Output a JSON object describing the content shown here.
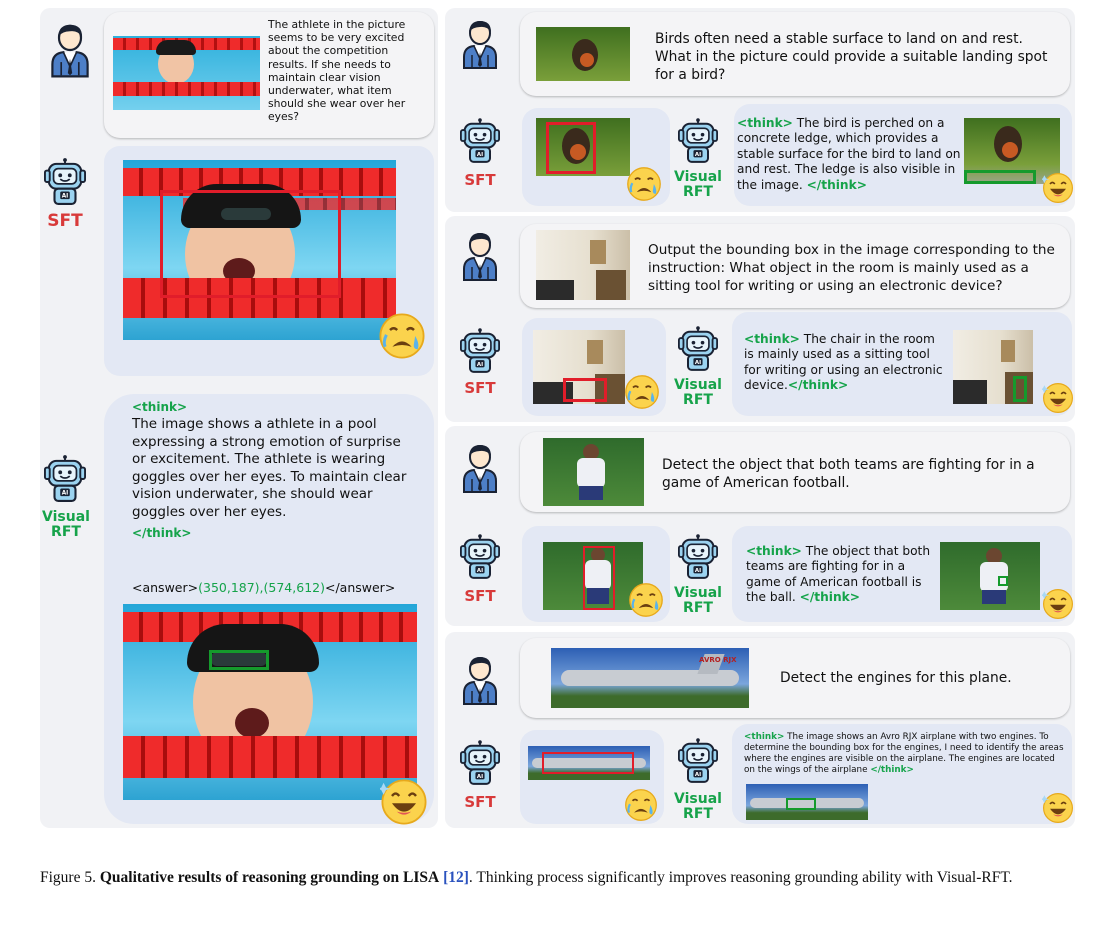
{
  "left": {
    "question": "The athlete in the picture seems to be very excited about the competition results. If she needs to maintain clear vision underwater, what item should she wear over her eyes?",
    "sft_label": "SFT",
    "rft_label": "Visual RFT",
    "think_open": "<think>",
    "think_body": "The image shows a athlete in a pool expressing a strong emotion of surprise or excitement. The athlete is wearing goggles over her eyes. To maintain clear vision underwater, she should wear goggles over her eyes.",
    "think_close": "</think>",
    "answer_open": "<answer>",
    "answer_value": "(350,187),(574,612)",
    "answer_close": "</answer>"
  },
  "examples": [
    {
      "question": "Birds often need a stable surface to land on and rest. What in the picture could provide a suitable landing spot for a bird?",
      "sft_label": "SFT",
      "rft_label": "Visual RFT",
      "think_open": "<think>",
      "think_body": "The bird is perched on a concrete ledge, which provides a stable surface for the bird to land on and rest. The ledge is also visible in the image.",
      "think_close": "</think>"
    },
    {
      "question": "Output the bounding box in the image corresponding to the instruction: What object in the room is mainly used as a sitting tool for writing or using an electronic device?",
      "sft_label": "SFT",
      "rft_label": "Visual RFT",
      "think_open": "<think>",
      "think_body": "The chair in the room is mainly used as a sitting tool for writing or using an electronic device.",
      "think_close": "</think>"
    },
    {
      "question": "Detect the object that both teams are fighting for in a game of American football.",
      "sft_label": "SFT",
      "rft_label": "Visual RFT",
      "think_open": "<think>",
      "think_body": "The object that both teams are fighting for in a game of American football is the ball.",
      "think_close": "</think>"
    },
    {
      "question": "Detect the engines for this plane.",
      "sft_label": "SFT",
      "rft_label": "Visual RFT",
      "think_open": "<think>",
      "think_body": "The image shows an Avro RJX airplane with two engines. To determine the bounding box for the engines, I need to identify the areas where the engines are visible on the airplane. The engines are located on the wings of the airplane",
      "think_close": "</think>",
      "plane_text": "AVRO RJX"
    }
  ],
  "caption": {
    "prefix": "Figure 5.",
    "bold": "Qualitative results of reasoning grounding on LISA",
    "ref": "[12]",
    "rest": ". Thinking process significantly improves reasoning grounding ability with Visual-RFT."
  },
  "colors": {
    "panel": "#f1f2f5",
    "answer_bubble": "#e3e8f4",
    "sft_red": "#d83a3a",
    "rft_green": "#16a34a",
    "think_green": "#15a34a",
    "ref_blue": "#2a52be"
  },
  "icons": [
    "user-icon",
    "robot-ai-icon",
    "crying-emoji-icon",
    "laughing-emoji-icon"
  ]
}
